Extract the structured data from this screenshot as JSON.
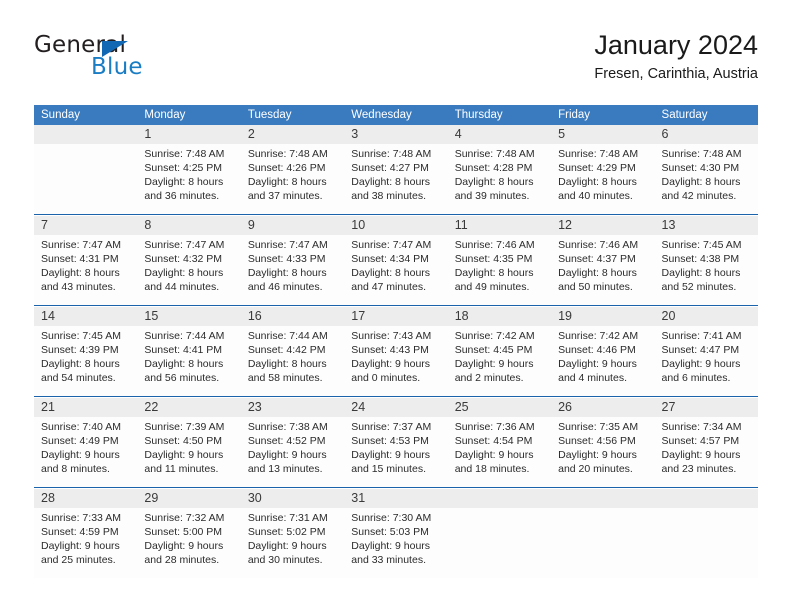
{
  "brand": {
    "name_part1": "General",
    "name_part2": "Blue"
  },
  "header": {
    "title": "January 2024",
    "subtitle": "Fresen, Carinthia, Austria"
  },
  "colors": {
    "header_blue": "#3a7bc0",
    "brand_blue": "#1a7dc4",
    "separator_blue": "#1b63ab",
    "daynumber_band": "#ededed"
  },
  "weekdays": [
    "Sunday",
    "Monday",
    "Tuesday",
    "Wednesday",
    "Thursday",
    "Friday",
    "Saturday"
  ],
  "weeks": [
    [
      {
        "day": "",
        "l1": "",
        "l2": "",
        "l3": "",
        "l4": ""
      },
      {
        "day": "1",
        "l1": "Sunrise: 7:48 AM",
        "l2": "Sunset: 4:25 PM",
        "l3": "Daylight: 8 hours",
        "l4": "and 36 minutes."
      },
      {
        "day": "2",
        "l1": "Sunrise: 7:48 AM",
        "l2": "Sunset: 4:26 PM",
        "l3": "Daylight: 8 hours",
        "l4": "and 37 minutes."
      },
      {
        "day": "3",
        "l1": "Sunrise: 7:48 AM",
        "l2": "Sunset: 4:27 PM",
        "l3": "Daylight: 8 hours",
        "l4": "and 38 minutes."
      },
      {
        "day": "4",
        "l1": "Sunrise: 7:48 AM",
        "l2": "Sunset: 4:28 PM",
        "l3": "Daylight: 8 hours",
        "l4": "and 39 minutes."
      },
      {
        "day": "5",
        "l1": "Sunrise: 7:48 AM",
        "l2": "Sunset: 4:29 PM",
        "l3": "Daylight: 8 hours",
        "l4": "and 40 minutes."
      },
      {
        "day": "6",
        "l1": "Sunrise: 7:48 AM",
        "l2": "Sunset: 4:30 PM",
        "l3": "Daylight: 8 hours",
        "l4": "and 42 minutes."
      }
    ],
    [
      {
        "day": "7",
        "l1": "Sunrise: 7:47 AM",
        "l2": "Sunset: 4:31 PM",
        "l3": "Daylight: 8 hours",
        "l4": "and 43 minutes."
      },
      {
        "day": "8",
        "l1": "Sunrise: 7:47 AM",
        "l2": "Sunset: 4:32 PM",
        "l3": "Daylight: 8 hours",
        "l4": "and 44 minutes."
      },
      {
        "day": "9",
        "l1": "Sunrise: 7:47 AM",
        "l2": "Sunset: 4:33 PM",
        "l3": "Daylight: 8 hours",
        "l4": "and 46 minutes."
      },
      {
        "day": "10",
        "l1": "Sunrise: 7:47 AM",
        "l2": "Sunset: 4:34 PM",
        "l3": "Daylight: 8 hours",
        "l4": "and 47 minutes."
      },
      {
        "day": "11",
        "l1": "Sunrise: 7:46 AM",
        "l2": "Sunset: 4:35 PM",
        "l3": "Daylight: 8 hours",
        "l4": "and 49 minutes."
      },
      {
        "day": "12",
        "l1": "Sunrise: 7:46 AM",
        "l2": "Sunset: 4:37 PM",
        "l3": "Daylight: 8 hours",
        "l4": "and 50 minutes."
      },
      {
        "day": "13",
        "l1": "Sunrise: 7:45 AM",
        "l2": "Sunset: 4:38 PM",
        "l3": "Daylight: 8 hours",
        "l4": "and 52 minutes."
      }
    ],
    [
      {
        "day": "14",
        "l1": "Sunrise: 7:45 AM",
        "l2": "Sunset: 4:39 PM",
        "l3": "Daylight: 8 hours",
        "l4": "and 54 minutes."
      },
      {
        "day": "15",
        "l1": "Sunrise: 7:44 AM",
        "l2": "Sunset: 4:41 PM",
        "l3": "Daylight: 8 hours",
        "l4": "and 56 minutes."
      },
      {
        "day": "16",
        "l1": "Sunrise: 7:44 AM",
        "l2": "Sunset: 4:42 PM",
        "l3": "Daylight: 8 hours",
        "l4": "and 58 minutes."
      },
      {
        "day": "17",
        "l1": "Sunrise: 7:43 AM",
        "l2": "Sunset: 4:43 PM",
        "l3": "Daylight: 9 hours",
        "l4": "and 0 minutes."
      },
      {
        "day": "18",
        "l1": "Sunrise: 7:42 AM",
        "l2": "Sunset: 4:45 PM",
        "l3": "Daylight: 9 hours",
        "l4": "and 2 minutes."
      },
      {
        "day": "19",
        "l1": "Sunrise: 7:42 AM",
        "l2": "Sunset: 4:46 PM",
        "l3": "Daylight: 9 hours",
        "l4": "and 4 minutes."
      },
      {
        "day": "20",
        "l1": "Sunrise: 7:41 AM",
        "l2": "Sunset: 4:47 PM",
        "l3": "Daylight: 9 hours",
        "l4": "and 6 minutes."
      }
    ],
    [
      {
        "day": "21",
        "l1": "Sunrise: 7:40 AM",
        "l2": "Sunset: 4:49 PM",
        "l3": "Daylight: 9 hours",
        "l4": "and 8 minutes."
      },
      {
        "day": "22",
        "l1": "Sunrise: 7:39 AM",
        "l2": "Sunset: 4:50 PM",
        "l3": "Daylight: 9 hours",
        "l4": "and 11 minutes."
      },
      {
        "day": "23",
        "l1": "Sunrise: 7:38 AM",
        "l2": "Sunset: 4:52 PM",
        "l3": "Daylight: 9 hours",
        "l4": "and 13 minutes."
      },
      {
        "day": "24",
        "l1": "Sunrise: 7:37 AM",
        "l2": "Sunset: 4:53 PM",
        "l3": "Daylight: 9 hours",
        "l4": "and 15 minutes."
      },
      {
        "day": "25",
        "l1": "Sunrise: 7:36 AM",
        "l2": "Sunset: 4:54 PM",
        "l3": "Daylight: 9 hours",
        "l4": "and 18 minutes."
      },
      {
        "day": "26",
        "l1": "Sunrise: 7:35 AM",
        "l2": "Sunset: 4:56 PM",
        "l3": "Daylight: 9 hours",
        "l4": "and 20 minutes."
      },
      {
        "day": "27",
        "l1": "Sunrise: 7:34 AM",
        "l2": "Sunset: 4:57 PM",
        "l3": "Daylight: 9 hours",
        "l4": "and 23 minutes."
      }
    ],
    [
      {
        "day": "28",
        "l1": "Sunrise: 7:33 AM",
        "l2": "Sunset: 4:59 PM",
        "l3": "Daylight: 9 hours",
        "l4": "and 25 minutes."
      },
      {
        "day": "29",
        "l1": "Sunrise: 7:32 AM",
        "l2": "Sunset: 5:00 PM",
        "l3": "Daylight: 9 hours",
        "l4": "and 28 minutes."
      },
      {
        "day": "30",
        "l1": "Sunrise: 7:31 AM",
        "l2": "Sunset: 5:02 PM",
        "l3": "Daylight: 9 hours",
        "l4": "and 30 minutes."
      },
      {
        "day": "31",
        "l1": "Sunrise: 7:30 AM",
        "l2": "Sunset: 5:03 PM",
        "l3": "Daylight: 9 hours",
        "l4": "and 33 minutes."
      },
      {
        "day": "",
        "l1": "",
        "l2": "",
        "l3": "",
        "l4": ""
      },
      {
        "day": "",
        "l1": "",
        "l2": "",
        "l3": "",
        "l4": ""
      },
      {
        "day": "",
        "l1": "",
        "l2": "",
        "l3": "",
        "l4": ""
      }
    ]
  ]
}
